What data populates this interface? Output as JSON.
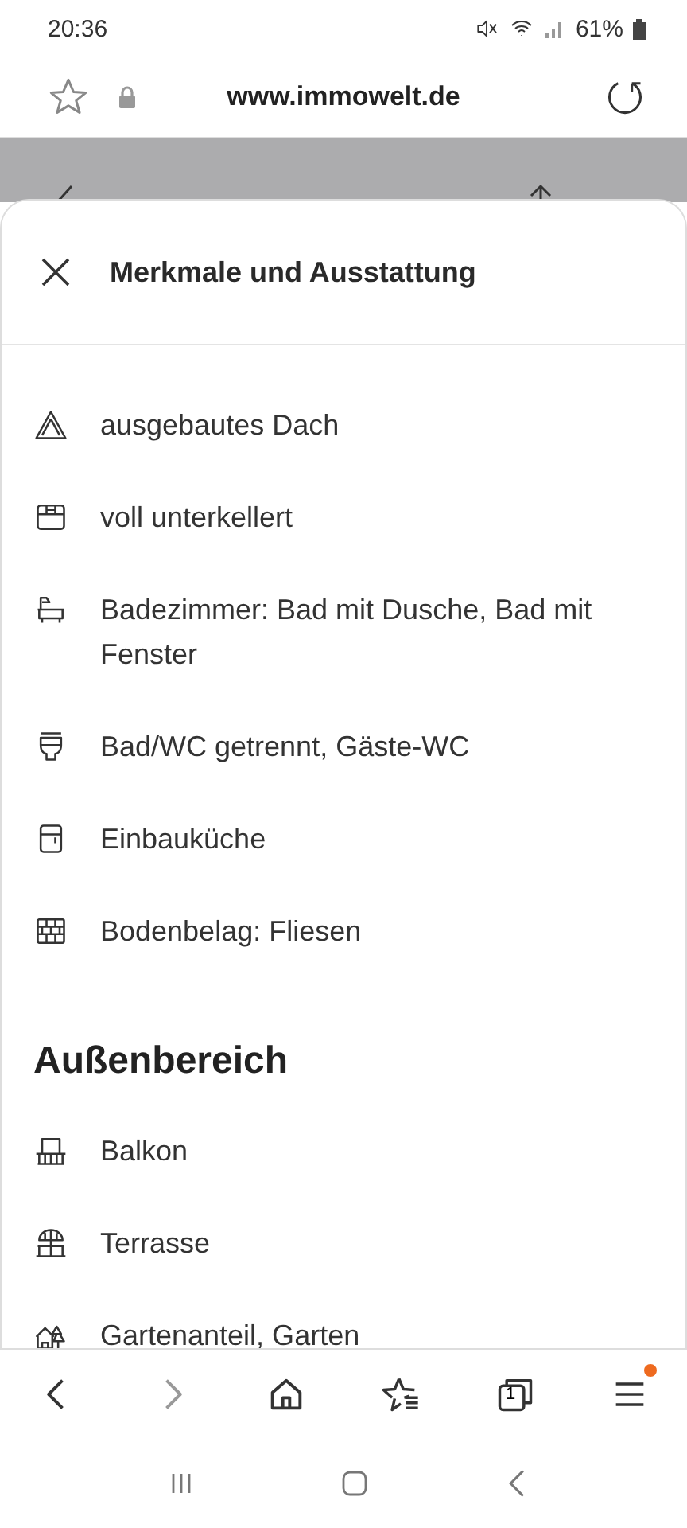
{
  "status_bar": {
    "time": "20:36",
    "battery": "61%"
  },
  "browser": {
    "url": "www.immowelt.de"
  },
  "sheet": {
    "title": "Merkmale und Ausstattung",
    "features": [
      {
        "kind": "roof",
        "label": "ausgebautes Dach"
      },
      {
        "kind": "cellar",
        "label": "voll unterkellert"
      },
      {
        "kind": "bath",
        "label": "Badezimmer: Bad mit Dusche, Bad mit Fenster"
      },
      {
        "kind": "toilet",
        "label": "Bad/WC getrennt, Gäste-WC"
      },
      {
        "kind": "kitchen",
        "label": "Einbauküche"
      },
      {
        "kind": "floor",
        "label": "Bodenbelag: Fliesen"
      }
    ],
    "section": {
      "title": "Außenbereich",
      "features": [
        {
          "kind": "balcony",
          "label": "Balkon"
        },
        {
          "kind": "terrace",
          "label": "Terrasse"
        },
        {
          "kind": "garden",
          "label": "Gartenanteil, Garten"
        }
      ]
    }
  },
  "toolbar": {
    "tab_count": "1",
    "menu_badge": true
  }
}
